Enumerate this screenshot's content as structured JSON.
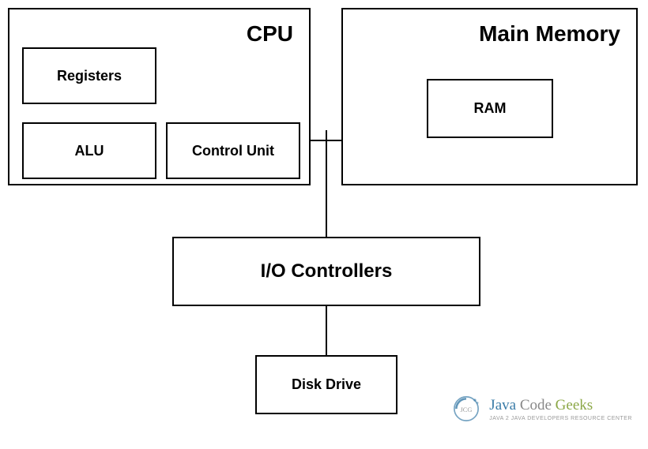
{
  "diagram": {
    "cpu": {
      "title": "CPU",
      "components": {
        "registers": "Registers",
        "alu": "ALU",
        "control_unit": "Control Unit"
      }
    },
    "memory": {
      "title": "Main Memory",
      "components": {
        "ram": "RAM"
      }
    },
    "io_controllers": {
      "label": "I/O Controllers"
    },
    "disk_drive": {
      "label": "Disk Drive"
    }
  },
  "watermark": {
    "brand_java": "Java",
    "brand_code": "Code",
    "brand_geeks": "Geeks",
    "tagline": "JAVA 2 JAVA DEVELOPERS RESOURCE CENTER",
    "icon_label": "JCG"
  }
}
